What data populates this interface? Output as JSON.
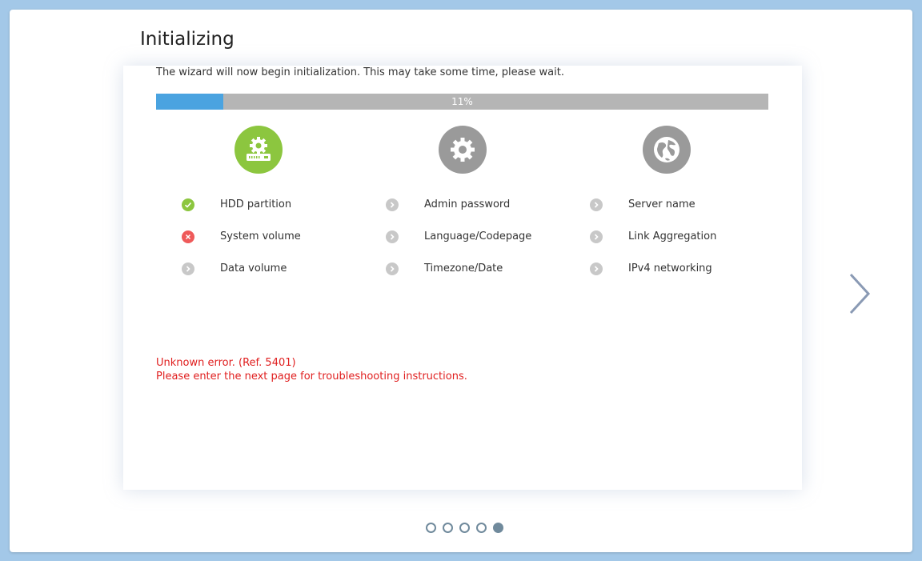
{
  "header": {
    "title": "Initializing"
  },
  "description": "The wizard will now begin initialization. This may take some time, please wait.",
  "progress": {
    "fraction": 0.11,
    "label": "11%"
  },
  "columns": [
    {
      "icon": "disk-gear-icon",
      "icon_color": "#8cc63f",
      "items": [
        {
          "label": "HDD partition",
          "status": "done"
        },
        {
          "label": "System volume",
          "status": "error"
        },
        {
          "label": "Data volume",
          "status": "pending"
        }
      ]
    },
    {
      "icon": "gear-icon",
      "icon_color": "#9a9a9a",
      "items": [
        {
          "label": "Admin password",
          "status": "pending"
        },
        {
          "label": "Language/Codepage",
          "status": "pending"
        },
        {
          "label": "Timezone/Date",
          "status": "pending"
        }
      ]
    },
    {
      "icon": "globe-icon",
      "icon_color": "#9a9a9a",
      "items": [
        {
          "label": "Server name",
          "status": "pending"
        },
        {
          "label": "Link Aggregation",
          "status": "pending"
        },
        {
          "label": "IPv4 networking",
          "status": "pending"
        }
      ]
    }
  ],
  "error": {
    "line1": "Unknown error. (Ref. 5401)",
    "line2": "Please enter the next page for troubleshooting instructions."
  },
  "pagination": {
    "total": 5,
    "active": 5
  },
  "colors": {
    "progress_fill": "#4aa3e0",
    "progress_track": "#b5b5b5",
    "error_text": "#e01f1f",
    "status_done": "#8cc63f",
    "status_error": "#ef5a5a",
    "status_pending": "#c8c8c8"
  }
}
